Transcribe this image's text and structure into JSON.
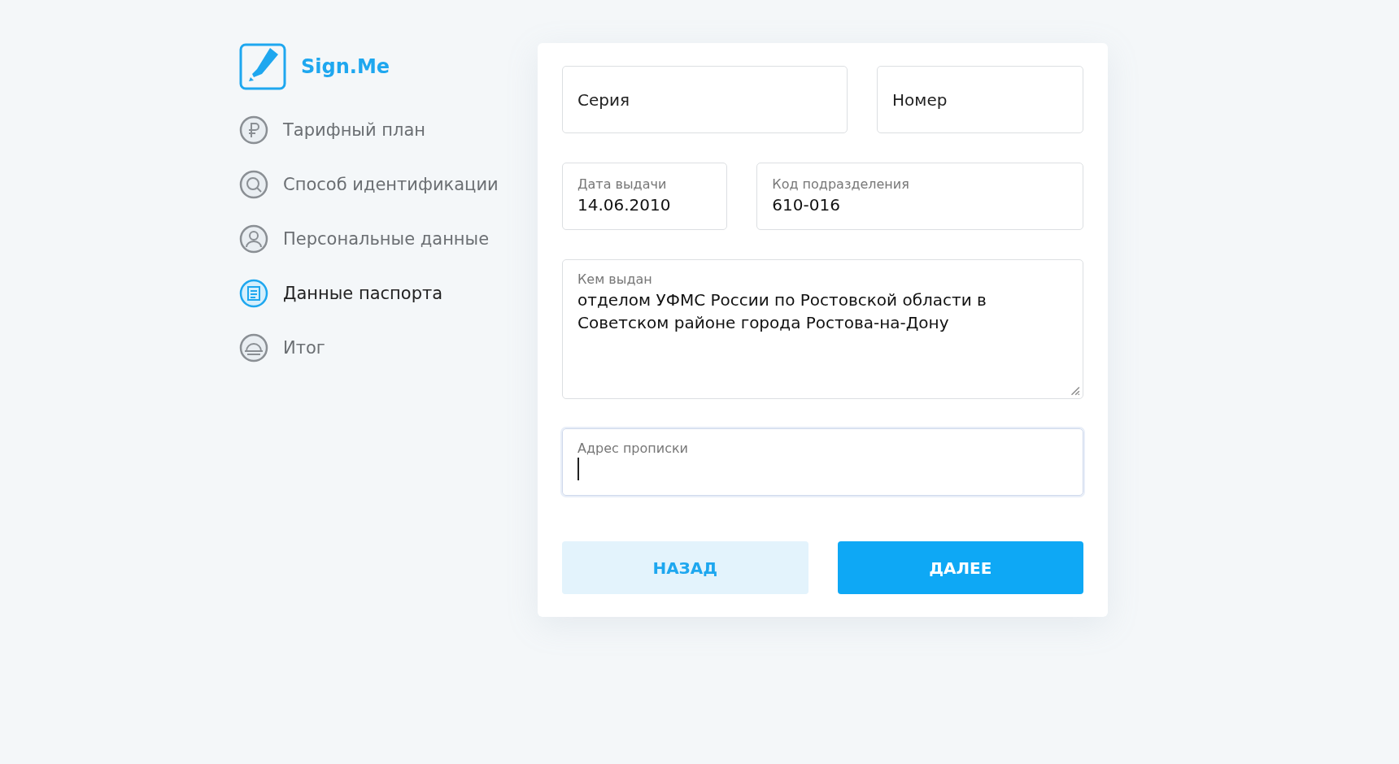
{
  "logo": {
    "text": "Sign.Me"
  },
  "steps": [
    {
      "label": "Тарифный план",
      "kind": "ruble",
      "selected": false
    },
    {
      "label": "Способ идентификации",
      "kind": "search",
      "selected": false
    },
    {
      "label": "Персональные данные",
      "kind": "person",
      "selected": false
    },
    {
      "label": "Данные паспорта",
      "kind": "document",
      "selected": true
    },
    {
      "label": "Итог",
      "kind": "final",
      "selected": false
    }
  ],
  "form": {
    "rows": [
      [
        {
          "kind": "input",
          "placeholder": "Серия",
          "focused": false
        },
        {
          "kind": "input",
          "placeholder": "Номер",
          "focused": false
        }
      ],
      [
        {
          "kind": "input",
          "label": "Дата выдачи",
          "value": "14.06.2010",
          "focused": false
        },
        {
          "kind": "input",
          "label": "Код подразделения",
          "value": "610-016",
          "focused": false
        }
      ],
      [
        {
          "kind": "textarea",
          "label": "Кем выдан",
          "value": "отделом УФМС России по Ростовской области в Советском районе города Ростова-на-Дону",
          "focused": false
        }
      ],
      [
        {
          "kind": "input",
          "label": "Адрес прописки",
          "focused": true
        }
      ]
    ],
    "buttons": [
      {
        "label": "НАЗАД",
        "kind": "secondary"
      },
      {
        "label": "ДАЛЕЕ",
        "kind": "primary"
      }
    ]
  }
}
